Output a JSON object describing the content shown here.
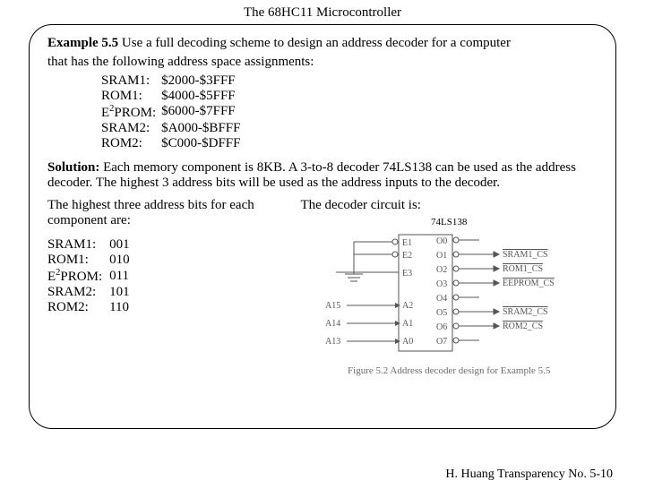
{
  "header": {
    "title": "The 68HC11 Microcontroller"
  },
  "example": {
    "label": "Example 5.5",
    "text_a": " Use a full decoding scheme to design an address decoder for a computer",
    "text_b": "that has the following address space assignments:",
    "assignments": [
      {
        "name": "SRAM1:",
        "range": "$2000-$3FFF"
      },
      {
        "name": "ROM1:",
        "range": "$4000-$5FFF"
      },
      {
        "name_html": "E<sup>2</sup>PROM:",
        "range": "$6000-$7FFF"
      },
      {
        "name": "SRAM2:",
        "range": "$A000-$BFFF"
      },
      {
        "name": "ROM2:",
        "range": "$C000-$DFFF"
      }
    ]
  },
  "solution": {
    "label": "Solution:",
    "text": " Each memory component is 8KB. A 3-to-8 decoder 74LS138 can be used as the address decoder. The highest 3 address bits will be used as the address inputs to the decoder."
  },
  "left_col": {
    "intro": "The highest three address bits for each component are:",
    "bits": [
      {
        "name": "SRAM1:",
        "val": "001"
      },
      {
        "name": "ROM1:",
        "val": "010"
      },
      {
        "name_html": "E<sup>2</sup>PROM:",
        "val": "011"
      },
      {
        "name": "SRAM2:",
        "val": "101"
      },
      {
        "name": "ROM2:",
        "val": "110"
      }
    ]
  },
  "right_col": {
    "intro": "The decoder circuit is:",
    "chip": "74LS138",
    "caption": "Figure 5.2 Address decoder design for Example 5.5",
    "pins_left": [
      "E1",
      "E2",
      "E3",
      "A2",
      "A1",
      "A0"
    ],
    "pins_right": [
      "O0",
      "O1",
      "O2",
      "O3",
      "O4",
      "O5",
      "O6",
      "O7"
    ],
    "addr_in": [
      "A15",
      "A14",
      "A13"
    ],
    "outputs_map": {
      "O1": "SRAM1_CS",
      "O2": "ROM1_CS",
      "O3": "EEPROM_CS",
      "O5": "SRAM2_CS",
      "O6": "ROM2_CS"
    }
  },
  "footer": {
    "text": "H. Huang Transparency No. 5-10"
  }
}
